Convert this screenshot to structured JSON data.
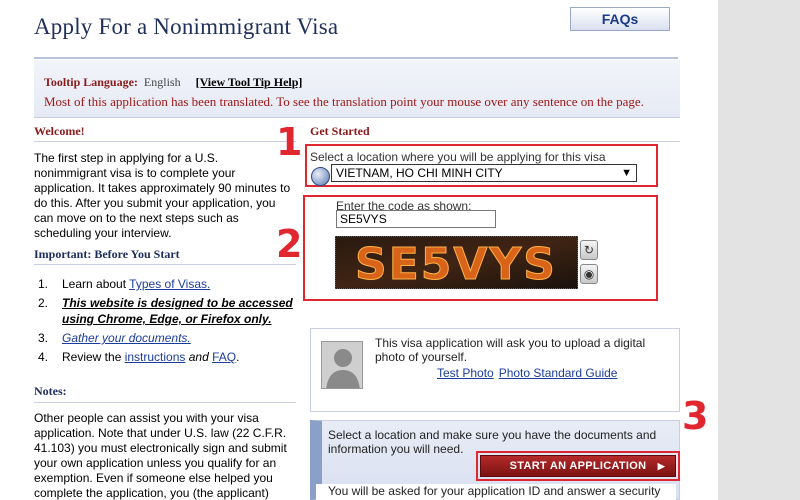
{
  "page": {
    "title": "Apply For a Nonimmigrant Visa",
    "faq_label": "FAQs"
  },
  "tooltip": {
    "language_label": "Tooltip Language:",
    "language_value": "English",
    "help_link": "[View Tool Tip Help]",
    "translation_note": "Most of this application has been translated. To see the translation point your mouse over any sentence on the page."
  },
  "welcome": {
    "heading": "Welcome!",
    "text": "The first step in applying for a U.S. nonimmigrant visa is to complete your application. It takes approximately 90 minutes to do this. After you submit your application, you can move on to the next steps such as scheduling your interview."
  },
  "important": {
    "heading": "Important: Before You Start",
    "steps": [
      {
        "num": "1.",
        "prefix": "Learn about ",
        "link": "Types of Visas."
      },
      {
        "num": "2.",
        "bold": "This website is designed to be accessed using Chrome, Edge, or Firefox only."
      },
      {
        "num": "3.",
        "link": "Gather your documents."
      },
      {
        "num": "4.",
        "prefix": "Review the ",
        "link": "instructions",
        "middle": " and ",
        "link2": "FAQ",
        "suffix": "."
      }
    ]
  },
  "notes": {
    "heading": "Notes:",
    "text": "Other people can assist you with your visa application. Note that under U.S. law (22 C.F.R. 41.103) you must electronically sign and submit your own application unless you qualify for an exemption. Even if someone else helped you complete the application, you (the applicant) must click the \"Sign Application\" button, or your"
  },
  "get_started": {
    "heading": "Get Started",
    "location_label": "Select a location where you will be applying for this visa",
    "location_value": "VIETNAM, HO CHI MINH CITY",
    "code_label": "Enter the code as shown:",
    "code_value": "SE5VYS",
    "captcha_text": "SE5VYS"
  },
  "annotations": {
    "one": "1",
    "two": "2",
    "three": "3",
    "color": "#e0262f"
  },
  "photo": {
    "text": "This visa application will ask you to upload a digital photo of yourself.",
    "link1": "Test Photo",
    "link2": "Photo Standard Guide"
  },
  "apply": {
    "text": "Select a location and make sure you have the documents and information you will need.",
    "button": "START AN APPLICATION",
    "bottom_text": "You will be asked for your application ID and answer a security"
  },
  "colors": {
    "title": "#20305a",
    "dark_red": "#8b1a1a",
    "button_red": "#9b1c1c",
    "link_blue": "#1c3c9c"
  }
}
